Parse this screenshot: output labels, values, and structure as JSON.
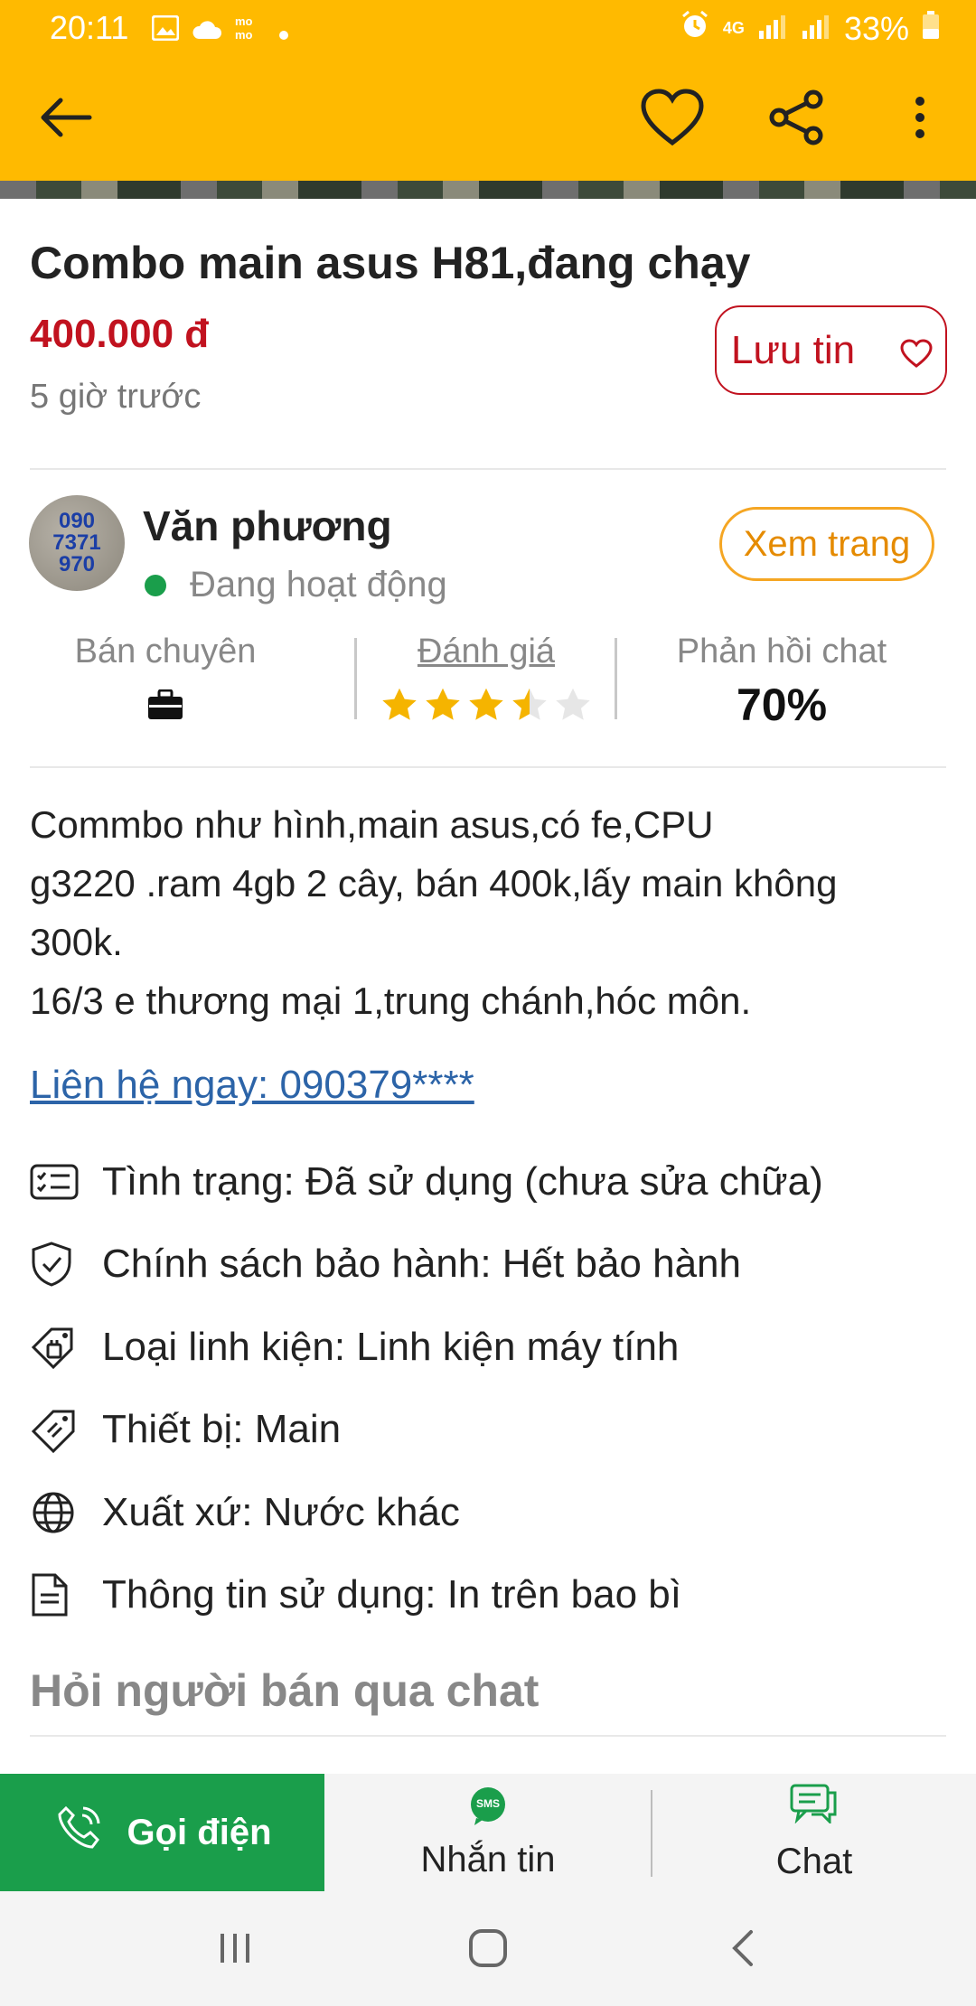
{
  "status_bar": {
    "time": "20:11",
    "network": "4G",
    "battery": "33%"
  },
  "listing": {
    "title": "Combo main asus H81,đang chạy",
    "price": "400.000 đ",
    "posted": "5 giờ trước",
    "save_label": "Lưu tin"
  },
  "seller": {
    "avatar_lines": [
      "090",
      "7371",
      "970"
    ],
    "name": "Văn phương",
    "status": "Đang hoạt động",
    "view_label": "Xem trang",
    "stats": {
      "type_label": "Bán chuyên",
      "rating_label": "Đánh giá",
      "rating_value": 3.5,
      "rating_max": 5,
      "response_label": "Phản hồi chat",
      "response_value": "70%"
    }
  },
  "description": {
    "lines": [
      "Commbo như hình,main asus,có fe,CPU",
      "g3220 .ram 4gb 2 cây, bán 400k,lấy main không",
      "300k.",
      "16/3 e thương mại 1,trung chánh,hóc môn."
    ],
    "contact": "Liên hệ ngay: 090379****"
  },
  "attributes": [
    {
      "icon": "checklist-icon",
      "text": "Tình trạng: Đã sử dụng (chưa sửa chữa)"
    },
    {
      "icon": "shield-check-icon",
      "text": "Chính sách bảo hành: Hết bảo hành"
    },
    {
      "icon": "component-tag-icon",
      "text": "Loại linh kiện: Linh kiện máy tính"
    },
    {
      "icon": "price-tag-icon",
      "text": "Thiết bị: Main"
    },
    {
      "icon": "globe-icon",
      "text": "Xuất xứ: Nước khác"
    },
    {
      "icon": "document-icon",
      "text": "Thông tin sử dụng: In trên bao bì"
    }
  ],
  "chat_section_title": "Hỏi người bán qua chat",
  "bottom_bar": {
    "call_label": "Gọi điện",
    "sms_label": "Nhắn tin",
    "sms_badge": "SMS",
    "chat_label": "Chat"
  },
  "colors": {
    "header": "#ffba00",
    "price": "#c1121f",
    "call": "#1a9e4b",
    "link": "#2c64a8",
    "view_button": "#f5a623"
  }
}
